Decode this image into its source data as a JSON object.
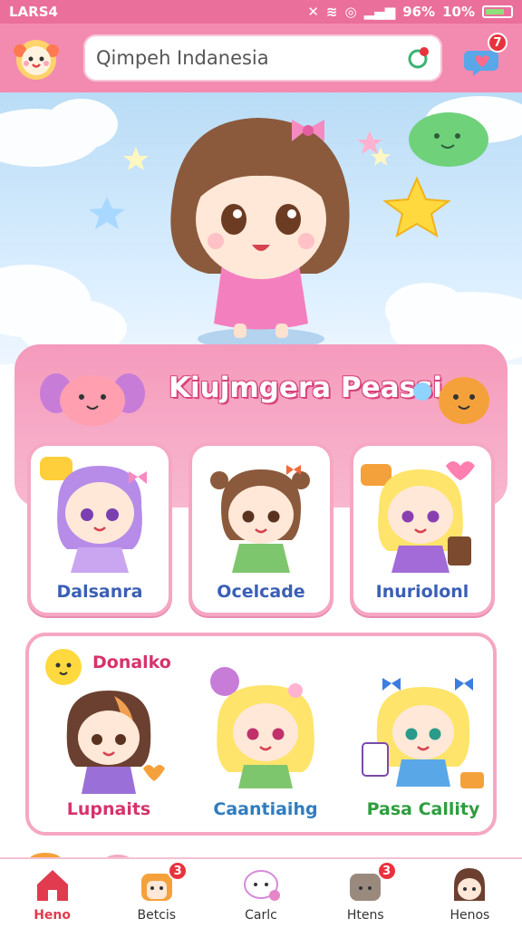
{
  "status_bar": {
    "carrier": "LARS4",
    "battery_percent": "96%",
    "extra": "10%",
    "icons": [
      "mute-icon",
      "wifi-icon",
      "alarm-icon",
      "signal-icon",
      "battery-icon"
    ]
  },
  "header": {
    "search_value": "Qimpeh Indanesia",
    "search_placeholder": "Qimpeh Indanesia",
    "notification_badge": "7"
  },
  "featured": {
    "title": "Kiujmgera Peassi"
  },
  "cards_row1": [
    {
      "label": "Dalsanra",
      "color": "#3a5fb5"
    },
    {
      "label": "Ocelcade",
      "color": "#3a5fb5"
    },
    {
      "label": "Inuriolonl",
      "color": "#3a5fb5"
    }
  ],
  "cards_row2": {
    "tag": "Donalko",
    "items": [
      {
        "label": "Lupnaits",
        "color": "#d6336c"
      },
      {
        "label": "Caantiaihg",
        "color": "#2f7dbf"
      },
      {
        "label": "Pasa Callity",
        "color": "#2e9e3e"
      }
    ]
  },
  "nav": [
    {
      "label": "Heno",
      "active": true,
      "badge": ""
    },
    {
      "label": "Betcis",
      "active": false,
      "badge": "3"
    },
    {
      "label": "Carlc",
      "active": false,
      "badge": ""
    },
    {
      "label": "Htens",
      "active": false,
      "badge": "3"
    },
    {
      "label": "Henos",
      "active": false,
      "badge": ""
    }
  ],
  "colors": {
    "header_pink": "#f38bb0",
    "status_pink": "#ea6f9a",
    "card_border": "#f6a7c3",
    "accent_red": "#e13b4f"
  }
}
